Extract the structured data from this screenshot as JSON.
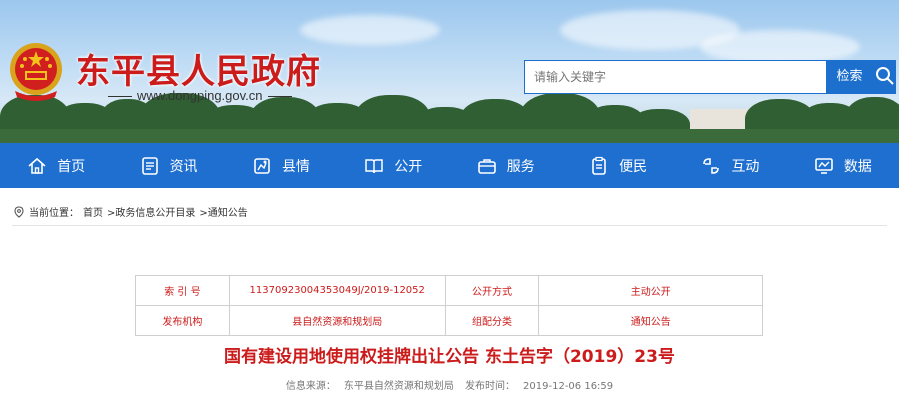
{
  "site": {
    "title": "东平县人民政府",
    "url": "www.dongping.gov.cn"
  },
  "search": {
    "placeholder": "请输入关键字",
    "button_label": "检索"
  },
  "nav": {
    "items": [
      {
        "label": "首页",
        "icon": "home-icon"
      },
      {
        "label": "资讯",
        "icon": "news-icon"
      },
      {
        "label": "县情",
        "icon": "county-icon"
      },
      {
        "label": "公开",
        "icon": "book-icon"
      },
      {
        "label": "服务",
        "icon": "briefcase-icon"
      },
      {
        "label": "便民",
        "icon": "clipboard-icon"
      },
      {
        "label": "互动",
        "icon": "interaction-icon"
      },
      {
        "label": "数据",
        "icon": "chart-monitor-icon"
      }
    ]
  },
  "breadcrumb": {
    "prefix": "当前位置：",
    "path": [
      "首页",
      ">政务信息公开目录",
      ">通知公告"
    ]
  },
  "meta": {
    "index_label": "索 引 号",
    "index_value": "11370923004353049J/2019-12052",
    "open_method_label": "公开方式",
    "open_method_value": "主动公开",
    "publisher_label": "发布机构",
    "publisher_value": "县自然资源和规划局",
    "category_label": "组配分类",
    "category_value": "通知公告"
  },
  "document": {
    "title": "国有建设用地使用权挂牌出让公告 东土告字（2019）23号",
    "source_label": "信息来源：",
    "source_value": "东平县自然资源和规划局",
    "time_label": "发布时间：",
    "time_value": "2019-12-06 16:59"
  },
  "colors": {
    "nav_blue": "#1e6fd0",
    "title_red": "#cc1b1b"
  }
}
